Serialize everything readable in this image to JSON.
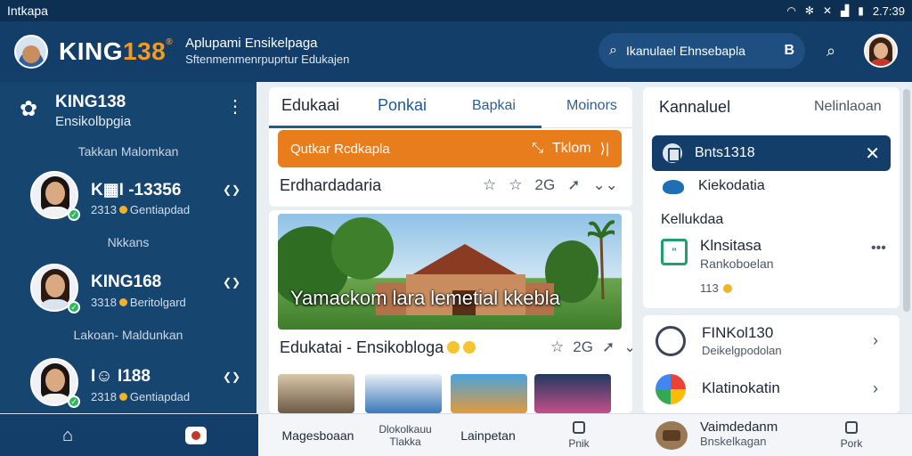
{
  "status_bar": {
    "app_name": "Intkapa",
    "time": "2.7:39"
  },
  "header": {
    "brand_main": "KING",
    "brand_accent": "138",
    "brand_mark": "®",
    "tagline_line1": "Aplupami Ensikelpaga",
    "tagline_line2": "Sftenmenmenrpuprtur Edukajen",
    "search_text": "Ikanulael Ehnsebapla",
    "search_suffix": "B"
  },
  "sidebar": {
    "title": "KING138",
    "subtitle": "Ensikolbpgia",
    "section_1": "Takkan Malomkan",
    "section_2": "Nkkans",
    "section_3": "Lakoan- Maldunkan",
    "contacts": [
      {
        "name": "K▦I -13356",
        "sub_left": "2313",
        "sub_right": "Gentiapdad"
      },
      {
        "name": "KING168",
        "sub_left": "3318",
        "sub_right": "Beritolgard"
      },
      {
        "name": "I☺ I188",
        "sub_left": "2318",
        "sub_right": "Gentiapdad"
      }
    ]
  },
  "center": {
    "tabs": [
      "Edukaai",
      "Ponkai",
      "Bapkai",
      "Moinors"
    ],
    "orange_bar_left": "Qutkar Rcdkapla",
    "orange_bar_right": "Tklom",
    "row_title": "Erdhardadaria",
    "row_count": "2G",
    "hero_caption": "Yamackom lara lemetial kkebla",
    "feature_title": "Edukatai - Ensikobloga",
    "feature_count": "2G"
  },
  "right_panel": {
    "title": "Kannaluel",
    "link": "Nelinlaoan",
    "selected_item": "Bnts1318",
    "item_1": "Kiekodatia",
    "item_2": "Kellukdaa",
    "item_3_title": "Klnsitasa",
    "item_3_sub": "Rankoboelan",
    "coins_text": "113",
    "list": [
      {
        "title": "FINKol130",
        "sub": "Deikelgpodolan"
      },
      {
        "title": "Klatinokatin",
        "sub": ""
      }
    ]
  },
  "bottom_nav": {
    "item_1": "Magesboaan",
    "item_2_line1": "Dlokolkauu",
    "item_2_line2": "Tlakka",
    "item_3": "Lainpetan",
    "item_4": "Pnik",
    "item_5_title": "Vaimdedanm",
    "item_5_sub": "Bnskelkagan",
    "item_6": "Pork"
  },
  "colors": {
    "primary": "#123e69",
    "accent": "#e87d1e",
    "online": "#2eb85c"
  }
}
